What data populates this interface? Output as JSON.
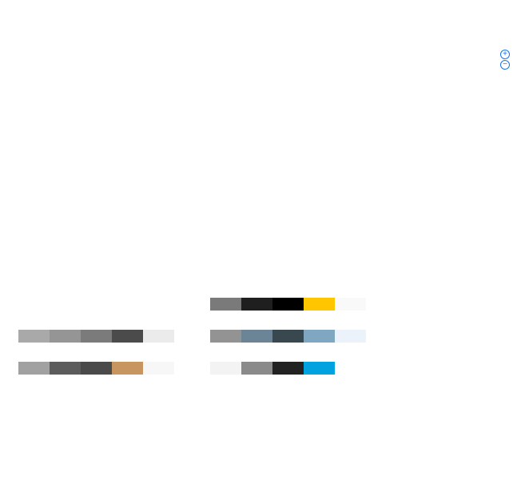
{
  "zoom": {
    "zoom_in_icon": "plus-circle-icon",
    "zoom_out_icon": "minus-circle-icon",
    "zoom_in_glyph": "+",
    "zoom_out_glyph": "−",
    "accent_color": "#1a73e8"
  },
  "palettes": [
    {
      "name": "palette-row-1-col-1",
      "colors": []
    },
    {
      "name": "palette-row-1-col-2",
      "colors": [
        "#7a7a7a",
        "#1f1f1f",
        "#000000",
        "#ffc600",
        "#f9f9f9"
      ]
    },
    {
      "name": "palette-row-2-col-1",
      "colors": [
        "#a9a9a9",
        "#959595",
        "#7b7b7b",
        "#4b4b4b",
        "#ebebeb"
      ]
    },
    {
      "name": "palette-row-2-col-2",
      "colors": [
        "#939393",
        "#6c8596",
        "#39474f",
        "#80a7c1",
        "#ebf2f9"
      ]
    },
    {
      "name": "palette-row-3-col-1",
      "colors": [
        "#a1a1a1",
        "#5c5c5c",
        "#4a4a4a",
        "#c69560",
        "#f7f7f7"
      ]
    },
    {
      "name": "palette-row-3-col-2",
      "colors": [
        "#f3f3f3",
        "#8a8a8a",
        "#222222",
        "#00a2e0",
        "#ffffff"
      ]
    }
  ]
}
